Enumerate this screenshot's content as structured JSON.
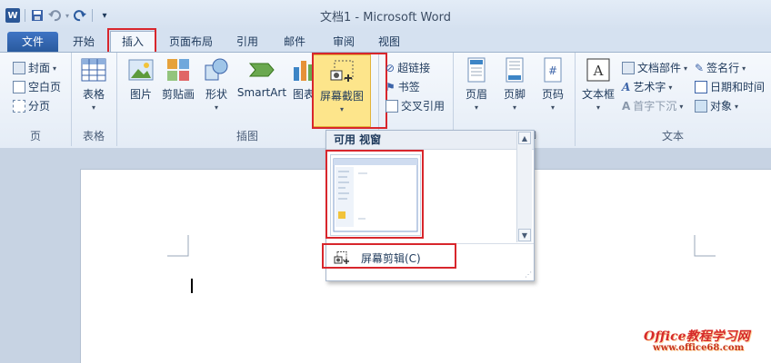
{
  "window": {
    "title": "文档1  -  Microsoft Word"
  },
  "qat": {
    "logo": "W",
    "save": "save-icon",
    "undo": "undo-icon",
    "redo": "redo-icon",
    "more": "▾"
  },
  "tabs": [
    {
      "label": "文件"
    },
    {
      "label": "开始"
    },
    {
      "label": "插入"
    },
    {
      "label": "页面布局"
    },
    {
      "label": "引用"
    },
    {
      "label": "邮件"
    },
    {
      "label": "审阅"
    },
    {
      "label": "视图"
    }
  ],
  "ribbon": {
    "pages": {
      "cover": "封面",
      "blank": "空白页",
      "break": "分页",
      "label": "页"
    },
    "tables": {
      "table": "表格",
      "label": "表格"
    },
    "illustrations": {
      "picture": "图片",
      "clipart": "剪贴画",
      "shapes": "形状",
      "smartart": "SmartArt",
      "chart": "图表",
      "screenshot": "屏幕截图",
      "label": "插图"
    },
    "links": {
      "hyperlink": "超链接",
      "bookmark": "书签",
      "crossref": "交叉引用"
    },
    "header_footer": {
      "header": "页眉",
      "footer": "页脚",
      "pagenum": "页码",
      "label_tail": "脚"
    },
    "text": {
      "textbox": "文本框",
      "quickparts": "文档部件",
      "wordart": "艺术字",
      "dropcap": "首字下沉",
      "signature": "签名行",
      "datetime": "日期和时间",
      "object": "对象",
      "label": "文本"
    }
  },
  "dropdown": {
    "header": "可用 视窗",
    "clip_label": "屏幕剪辑(C)"
  },
  "watermark": {
    "main": "Office教程学习网",
    "sub": "www.office68.com"
  },
  "colors": {
    "highlight": "#d8262c",
    "file_tab": "#2a5a9e",
    "selected_btn": "#fde58b"
  }
}
